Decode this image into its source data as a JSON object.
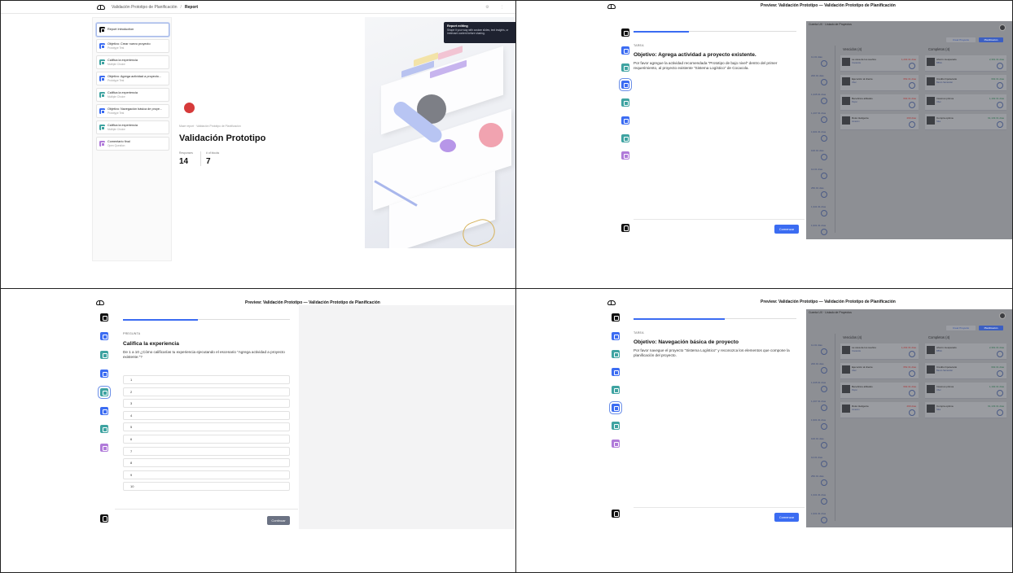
{
  "panel1": {
    "breadcrumb": {
      "project": "Validación Prototipo de Planificación",
      "current": "Report"
    },
    "blocks": [
      {
        "title": "Report Introduction",
        "subtitle": "",
        "color": "dark"
      },
      {
        "title": "Objetivo: Crear nuevo proyecto",
        "subtitle": "Prototype Test",
        "color": "blue"
      },
      {
        "title": "Califica la experiencia",
        "subtitle": "Multiple Choice",
        "color": "teal"
      },
      {
        "title": "Objetivo: Agrega actividad a proyecto...",
        "subtitle": "Prototype Test",
        "color": "blue"
      },
      {
        "title": "Califica la experiencia",
        "subtitle": "Multiple Choice",
        "color": "teal"
      },
      {
        "title": "Objetivo: Navegación básica de proye...",
        "subtitle": "Prototype Test",
        "color": "blue"
      },
      {
        "title": "Califica la experiencia",
        "subtitle": "Multiple Choice",
        "color": "teal"
      },
      {
        "title": "Comentario final",
        "subtitle": "Open Question",
        "color": "purple"
      }
    ],
    "report": {
      "breadcrumb": "Maze report · Validación Prototipo de Planificación",
      "title": "Validación Prototipo",
      "stats": [
        {
          "label": "Responses",
          "value": "14"
        },
        {
          "label": "# of blocks",
          "value": "7"
        }
      ]
    },
    "tooltip": {
      "title": "Report editing",
      "body": "Shape it your way with custom slides, text insights, or irrelevant content before sharing."
    }
  },
  "preview_title": "Preview: Validación Prototipo — Validación Prototipo de Planificación",
  "panel2": {
    "kicker": "TAREA",
    "title": "Objetivo: Agrega actividad a proyecto existente.",
    "body": "Por favor agregue la actividad recomendada \"Prototipo de bajo nivel\" dentro del primer requerimiento, al proyecto existente \"Sistema Logístico\" de Cocacola.",
    "button": "Comenzar",
    "progress": 0.34
  },
  "panel3": {
    "kicker": "PREGUNTA",
    "title": "Califica la experiencia",
    "body": "De 1 a 10 ¿Cómo calificarías tu experiencia ejecutando el escenario \"Agrega actividad a proyecto existente.\"?",
    "options": [
      "1",
      "2",
      "3",
      "4",
      "5",
      "6",
      "7",
      "8",
      "9",
      "10"
    ],
    "button": "Continuar",
    "progress": 0.45
  },
  "panel4": {
    "kicker": "TAREA",
    "title": "Objetivo: Navegación básica de proyecto",
    "body": "Por favor navegue el proyecto \"Sistema Logístico\" y reconozca los elementos que compone la planificación del proyecto.",
    "button": "Comenzar",
    "progress": 0.56
  },
  "background_app": {
    "header": "Cuenta UX · Listado de Proyectos",
    "create_button": "Crear Proyecto",
    "plan_button": "Planificación",
    "vencidos_title": "Vencidos (4)",
    "completos_title": "Completos (4)",
    "vencidos": [
      {
        "name": "La casa de los sueños",
        "sub": "Cocacola",
        "amount": "1,232.31 días"
      },
      {
        "name": "Ejecución al cliente",
        "sub": "Uber",
        "amount": "652.31 días"
      },
      {
        "name": "Beneficios afiliados",
        "sub": "Pepsi",
        "amount": "602.31 días"
      },
      {
        "name": "Ruta inteligente",
        "sub": "Amazon",
        "amount": "299 días"
      }
    ],
    "completos": [
      {
        "name": "Ahorro inesperado",
        "sub": "BBVA",
        "amount": "2,391.31 días"
      },
      {
        "name": "Crédito hipotecario",
        "sub": "Banco Santander",
        "amount": "602.31 días"
      },
      {
        "name": "Insumos primos",
        "sub": "Uber",
        "amount": "1,192.31 días"
      },
      {
        "name": "Compra optima",
        "sub": "Nike",
        "amount": "91,133.31 días"
      }
    ],
    "lane": [
      "11.01 días",
      "200.01 días",
      "1,345.31 días",
      "1,437.31 días",
      "1,931.31 días",
      "100.01 días",
      "12.01 días",
      "250.01 días",
      "1,341.31 días",
      "1,931.31 días"
    ]
  },
  "colors": {
    "accent": "#3b6cf2",
    "teal": "#3ea3a1",
    "purple": "#b07ad9",
    "muted_button": "#6b7283"
  }
}
